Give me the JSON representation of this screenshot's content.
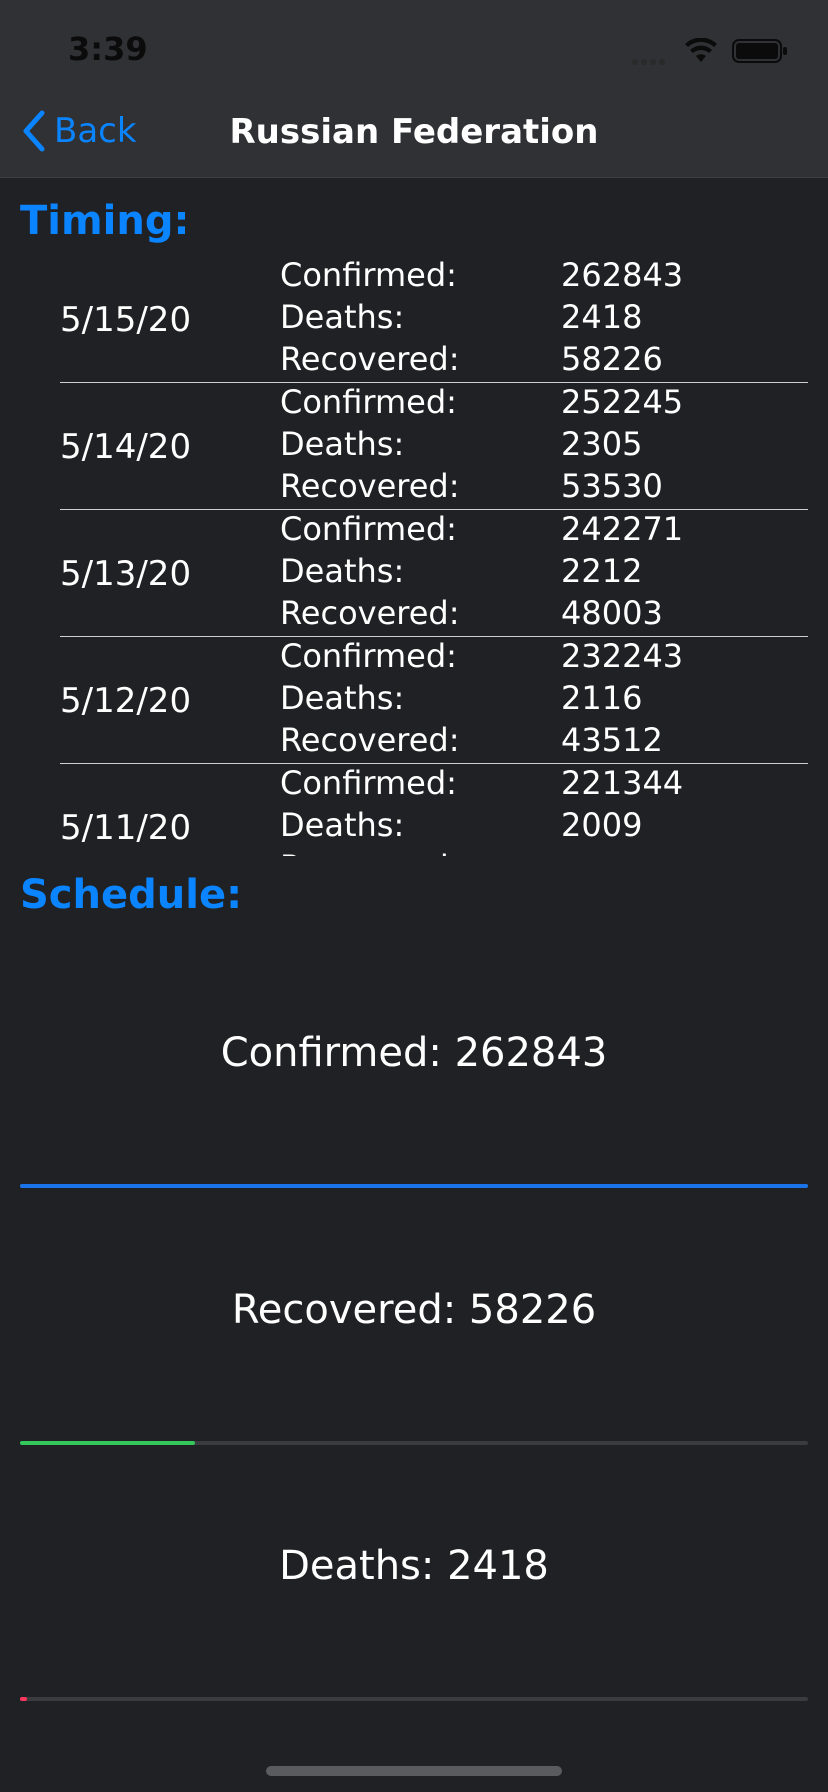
{
  "status_bar": {
    "time": "3:39"
  },
  "nav": {
    "back_label": "Back",
    "title": "Russian Federation"
  },
  "timing": {
    "title": "Timing:",
    "days": [
      {
        "date": "5/15/20",
        "confirmed_label": "Confirmed:",
        "confirmed": "262843",
        "deaths_label": "Deaths:",
        "deaths": "2418",
        "recovered_label": "Recovered:",
        "recovered": "58226"
      },
      {
        "date": "5/14/20",
        "confirmed_label": "Confirmed:",
        "confirmed": "252245",
        "deaths_label": "Deaths:",
        "deaths": "2305",
        "recovered_label": "Recovered:",
        "recovered": "53530"
      },
      {
        "date": "5/13/20",
        "confirmed_label": "Confirmed:",
        "confirmed": "242271",
        "deaths_label": "Deaths:",
        "deaths": "2212",
        "recovered_label": "Recovered:",
        "recovered": "48003"
      },
      {
        "date": "5/12/20",
        "confirmed_label": "Confirmed:",
        "confirmed": "232243",
        "deaths_label": "Deaths:",
        "deaths": "2116",
        "recovered_label": "Recovered:",
        "recovered": "43512"
      },
      {
        "date": "5/11/20",
        "confirmed_label": "Confirmed:",
        "confirmed": "221344",
        "deaths_label": "Deaths:",
        "deaths": "2009",
        "recovered_label": "Recovered:",
        "recovered": ""
      }
    ]
  },
  "schedule": {
    "title": "Schedule:",
    "confirmed": {
      "text": "Confirmed: 262843",
      "fraction": 1.0,
      "color": "#1a73e8"
    },
    "recovered": {
      "text": "Recovered: 58226",
      "fraction": 0.2215,
      "color": "#34c759"
    },
    "deaths": {
      "text": "Deaths: 2418",
      "fraction": 0.0092,
      "color": "#ff375f"
    }
  },
  "icons": {
    "back": "chevron-left-icon",
    "wifi": "wifi-icon",
    "battery": "battery-icon"
  }
}
